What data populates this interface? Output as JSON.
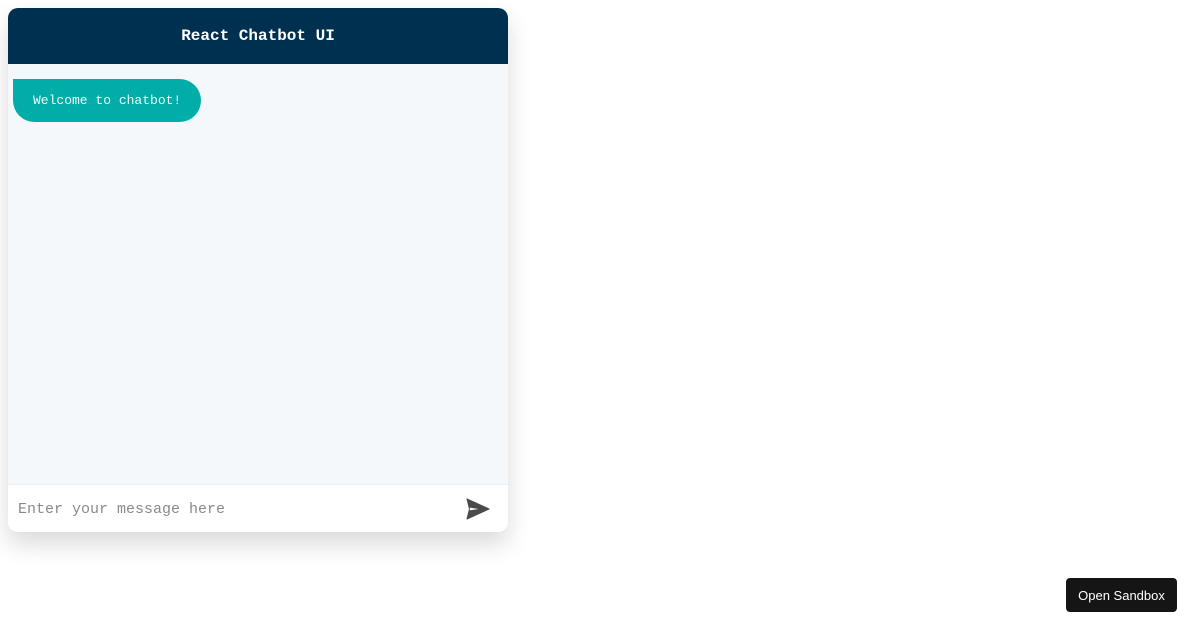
{
  "chat": {
    "title": "React Chatbot UI",
    "messages": [
      {
        "from": "bot",
        "text": "Welcome to chatbot!"
      }
    ],
    "input": {
      "value": "",
      "placeholder": "Enter your message here"
    },
    "send_icon": "send-icon"
  },
  "sandbox": {
    "label": "Open Sandbox"
  },
  "colors": {
    "header": "#00304f",
    "bot_bubble": "#00ada8",
    "body": "#f5f8fb",
    "sandbox_button": "#151515"
  }
}
